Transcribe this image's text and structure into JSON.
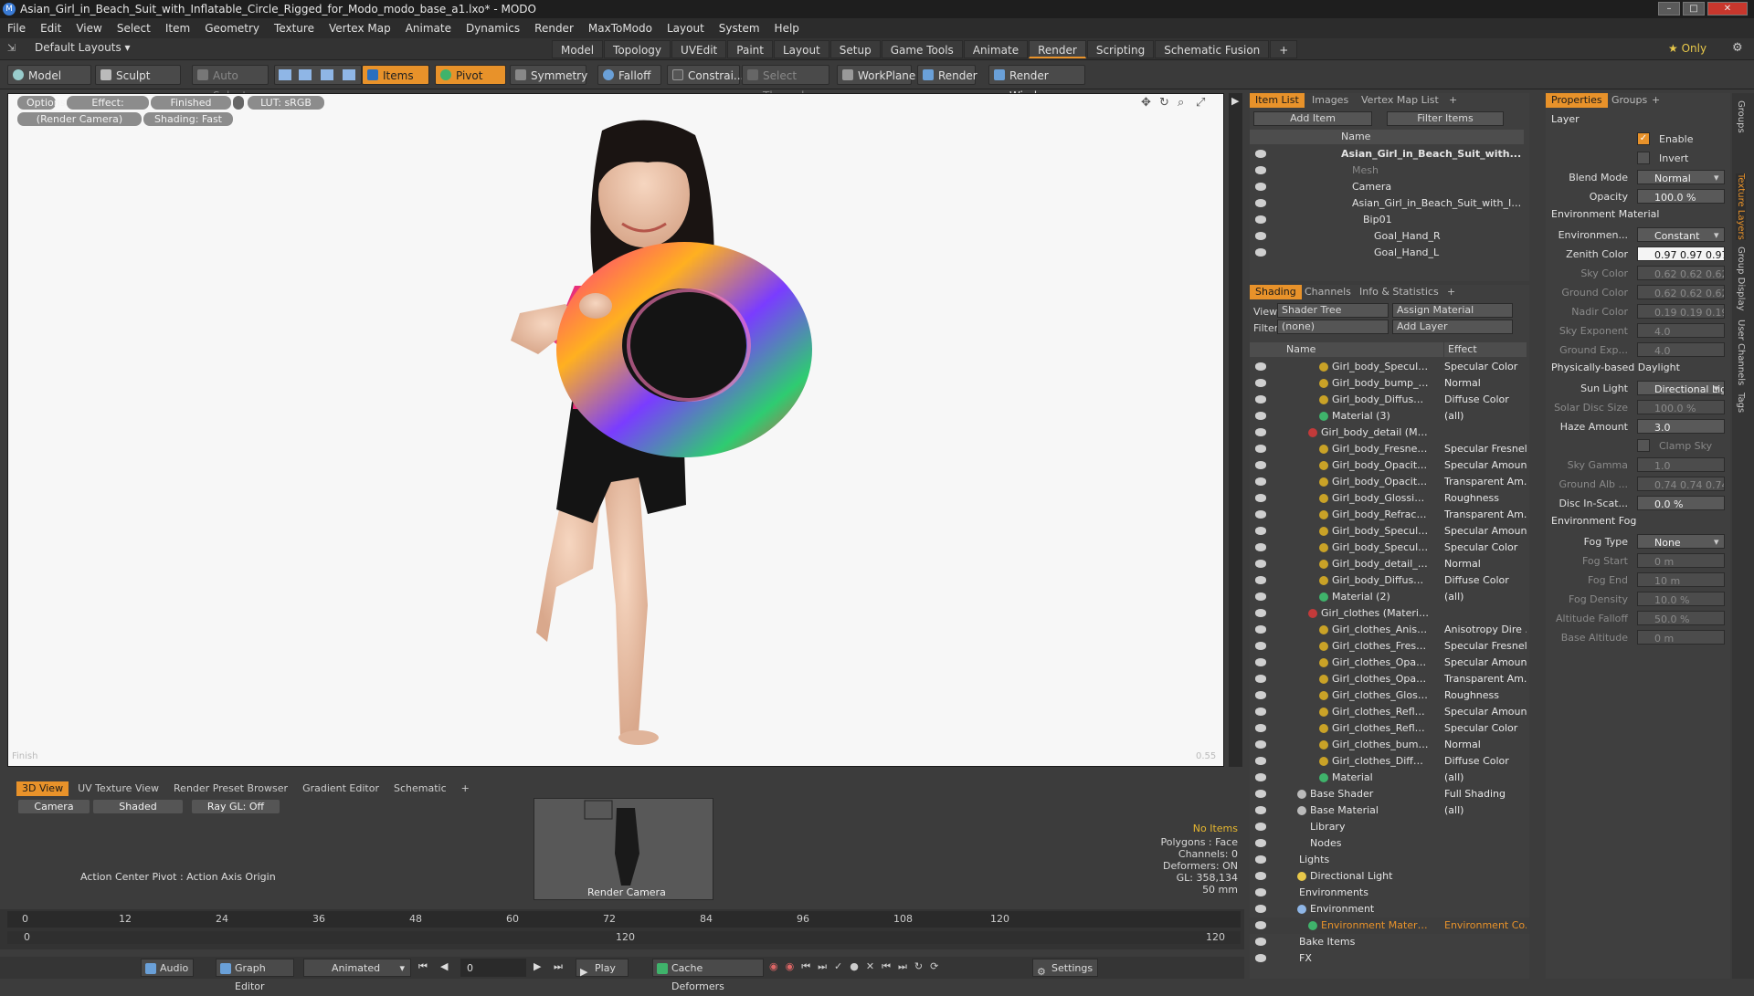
{
  "window": {
    "title": "Asian_Girl_in_Beach_Suit_with_Inflatable_Circle_Rigged_for_Modo_modo_base_a1.lxo* - MODO"
  },
  "menu": [
    "File",
    "Edit",
    "View",
    "Select",
    "Item",
    "Geometry",
    "Texture",
    "Vertex Map",
    "Animate",
    "Dynamics",
    "Render",
    "MaxToModo",
    "Layout",
    "System",
    "Help"
  ],
  "layout": {
    "dropdown": "Default Layouts ▾",
    "tabs": [
      "Model",
      "Topology",
      "UVEdit",
      "Paint",
      "Layout",
      "Setup",
      "Game Tools",
      "Animate",
      "Render",
      "Scripting",
      "Schematic Fusion",
      "+"
    ],
    "active": "Render",
    "only": "★ Only"
  },
  "toolbar": {
    "model": "Model",
    "sculpt": "Sculpt",
    "auto_select": "Auto Select",
    "items": "Items",
    "pivot": "Pivot",
    "symmetry": "Symmetry",
    "falloff": "Falloff",
    "constraints": "Constrai...",
    "select_through": "Select Through",
    "workplane": "WorkPlane",
    "render": "Render",
    "render_window": "Render Window"
  },
  "viewport": {
    "options": "Options",
    "effect": "Effect: (Shadi...",
    "finished": "Finished",
    "lut": "LUT: sRGB",
    "camera": "(Render Camera)",
    "shading": "Shading: Fast",
    "corner_left": "Finish",
    "corner_right": "0.55"
  },
  "bottom": {
    "tabs": [
      "3D View",
      "UV Texture View",
      "Render Preset Browser",
      "Gradient Editor",
      "Schematic",
      "+"
    ],
    "camera": "Camera",
    "shaded": "Shaded",
    "raygl": "Ray GL: Off",
    "action": "Action Center Pivot : Action Axis Origin",
    "render_camera": "Render Camera",
    "info": [
      "No Items",
      "Polygons : Face",
      "Channels: 0",
      "Deformers: ON",
      "GL: 358,134",
      "50 mm"
    ]
  },
  "timeline": {
    "ticks": [
      "0",
      "12",
      "24",
      "36",
      "48",
      "60",
      "72",
      "84",
      "96",
      "108",
      "120"
    ],
    "sub": [
      "0",
      "120",
      "120"
    ]
  },
  "playbar": {
    "audio": "Audio",
    "graph": "Graph Editor",
    "animated": "Animated",
    "frame": "0",
    "play": "Play",
    "cache": "Cache Deformers",
    "settings": "Settings"
  },
  "itemlist": {
    "tabs": [
      "Item List",
      "Images",
      "Vertex Map List",
      "+"
    ],
    "add_item": "Add Item",
    "filter": "Filter Items",
    "col": "Name",
    "rows": [
      {
        "t": "Asian_Girl_in_Beach_Suit_with...",
        "d": 0,
        "b": true
      },
      {
        "t": "Mesh",
        "d": 1,
        "dim": true
      },
      {
        "t": "Camera",
        "d": 1
      },
      {
        "t": "Asian_Girl_in_Beach_Suit_with_In...",
        "d": 1
      },
      {
        "t": "Bip01",
        "d": 2
      },
      {
        "t": "Goal_Hand_R",
        "d": 3
      },
      {
        "t": "Goal_Hand_L",
        "d": 3
      }
    ]
  },
  "shading": {
    "tabs": [
      "Shading",
      "Channels",
      "Info & Statistics",
      "+"
    ],
    "view_label": "View",
    "view": "Shader Tree",
    "assign": "Assign Material",
    "filter_label": "Filter",
    "filter": "(none)",
    "add_layer": "Add Layer",
    "col_name": "Name",
    "col_effect": "Effect",
    "rows": [
      {
        "n": "Girl_body_Specular...",
        "e": "Specular Color",
        "d": 3,
        "c": "#c9a227"
      },
      {
        "n": "Girl_body_bump_b ...",
        "e": "Normal",
        "d": 3,
        "c": "#c9a227"
      },
      {
        "n": "Girl_body_Diffuse (...",
        "e": "Diffuse Color",
        "d": 3,
        "c": "#c9a227"
      },
      {
        "n": "Material (3)",
        "e": "(all)",
        "d": 3,
        "c": "#3fb36b"
      },
      {
        "n": "Girl_body_detail (Mat...",
        "e": "",
        "d": 2,
        "c": "#c23a3a"
      },
      {
        "n": "Girl_body_Fresnel ...",
        "e": "Specular Fresnel",
        "d": 3,
        "c": "#c9a227"
      },
      {
        "n": "Girl_body_Opacity ...",
        "e": "Specular Amount",
        "d": 3,
        "c": "#c9a227"
      },
      {
        "n": "Girl_body_Opacity ...",
        "e": "Transparent Am...",
        "d": 3,
        "c": "#c9a227"
      },
      {
        "n": "Girl_body_Glossine ...",
        "e": "Roughness",
        "d": 3,
        "c": "#c9a227"
      },
      {
        "n": "Girl_body_Refracti ...",
        "e": "Transparent Am...",
        "d": 3,
        "c": "#c9a227"
      },
      {
        "n": "Girl_body_Specular...",
        "e": "Specular Amount",
        "d": 3,
        "c": "#c9a227"
      },
      {
        "n": "Girl_body_Specular...",
        "e": "Specular Color",
        "d": 3,
        "c": "#c9a227"
      },
      {
        "n": "Girl_body_detail_b ...",
        "e": "Normal",
        "d": 3,
        "c": "#c9a227"
      },
      {
        "n": "Girl_body_Diffuse (...",
        "e": "Diffuse Color",
        "d": 3,
        "c": "#c9a227"
      },
      {
        "n": "Material (2)",
        "e": "(all)",
        "d": 3,
        "c": "#3fb36b"
      },
      {
        "n": "Girl_clothes (Material)",
        "e": "",
        "d": 2,
        "c": "#c23a3a"
      },
      {
        "n": "Girl_clothes_Anisot ...",
        "e": "Anisotropy Dire ...",
        "d": 3,
        "c": "#c9a227"
      },
      {
        "n": "Girl_clothes_Fresn ...",
        "e": "Specular Fresnel",
        "d": 3,
        "c": "#c9a227"
      },
      {
        "n": "Girl_clothes_Opacit...",
        "e": "Specular Amount",
        "d": 3,
        "c": "#c9a227"
      },
      {
        "n": "Girl_clothes_Opacit...",
        "e": "Transparent Am...",
        "d": 3,
        "c": "#c9a227"
      },
      {
        "n": "Girl_clothes_Glossi ...",
        "e": "Roughness",
        "d": 3,
        "c": "#c9a227"
      },
      {
        "n": "Girl_clothes_Reflec ...",
        "e": "Specular Amount",
        "d": 3,
        "c": "#c9a227"
      },
      {
        "n": "Girl_clothes_Reflec ...",
        "e": "Specular Color",
        "d": 3,
        "c": "#c9a227"
      },
      {
        "n": "Girl_clothes_bump_...",
        "e": "Normal",
        "d": 3,
        "c": "#c9a227"
      },
      {
        "n": "Girl_clothes_Diffus ...",
        "e": "Diffuse Color",
        "d": 3,
        "c": "#c9a227"
      },
      {
        "n": "Material",
        "e": "(all)",
        "d": 3,
        "c": "#3fb36b"
      },
      {
        "n": "Base Shader",
        "e": "Full Shading",
        "d": 1,
        "c": "#bbbbbb"
      },
      {
        "n": "Base Material",
        "e": "(all)",
        "d": 1,
        "c": "#bbbbbb"
      },
      {
        "n": "Library",
        "e": "",
        "d": 1,
        "c": ""
      },
      {
        "n": "Nodes",
        "e": "",
        "d": 1,
        "c": ""
      },
      {
        "n": "Lights",
        "e": "",
        "d": 0,
        "c": ""
      },
      {
        "n": "Directional Light",
        "e": "",
        "d": 1,
        "c": "#e8c84a"
      },
      {
        "n": "Environments",
        "e": "",
        "d": 0,
        "c": ""
      },
      {
        "n": "Environment",
        "e": "",
        "d": 1,
        "c": "#8fb6e6"
      },
      {
        "n": "Environment Material",
        "e": "Environment Co...",
        "d": 2,
        "c": "#3fb36b",
        "sel": true
      },
      {
        "n": "Bake Items",
        "e": "",
        "d": 0,
        "c": ""
      },
      {
        "n": "FX",
        "e": "",
        "d": 0,
        "c": ""
      }
    ]
  },
  "props": {
    "tabs": [
      "Properties",
      "Groups",
      "+"
    ],
    "layer": "Layer",
    "rows": [
      {
        "l": "",
        "v": "Enable",
        "k": "check"
      },
      {
        "l": "",
        "v": "Invert",
        "k": "check2"
      },
      {
        "l": "Blend Mode",
        "v": "Normal",
        "k": "drop"
      },
      {
        "l": "Opacity",
        "v": "100.0 %",
        "k": "num"
      },
      {
        "s": "Environment Material"
      },
      {
        "l": "Environmen...",
        "v": "Constant",
        "k": "drop"
      },
      {
        "l": "Zenith Color",
        "v": "0.97 0.97 0.97",
        "k": "white"
      },
      {
        "l": "Sky Color",
        "v": "0.62 0.62 0.62",
        "k": "dim"
      },
      {
        "l": "Ground Color",
        "v": "0.62 0.62 0.62",
        "k": "dim"
      },
      {
        "l": "Nadir Color",
        "v": "0.19 0.19 0.19",
        "k": "dim"
      },
      {
        "l": "Sky Exponent",
        "v": "4.0",
        "k": "dim"
      },
      {
        "l": "Ground Exp...",
        "v": "4.0",
        "k": "dim"
      },
      {
        "s": "Physically-based Daylight"
      },
      {
        "l": "Sun Light",
        "v": "Directional Light",
        "k": "drop"
      },
      {
        "l": "Solar Disc Size",
        "v": "100.0 %",
        "k": "dim"
      },
      {
        "l": "Haze Amount",
        "v": "3.0",
        "k": "num"
      },
      {
        "l": "",
        "v": "Clamp Sky Brig...",
        "k": "dimcheck"
      },
      {
        "l": "Sky Gamma",
        "v": "1.0",
        "k": "dim"
      },
      {
        "l": "Ground Alb ...",
        "v": "0.74 0.74 0.74",
        "k": "dim"
      },
      {
        "l": "Disc In-Scat...",
        "v": "0.0 %",
        "k": "num"
      },
      {
        "s": "Environment Fog"
      },
      {
        "l": "Fog Type",
        "v": "None",
        "k": "drop"
      },
      {
        "l": "Fog Start",
        "v": "0 m",
        "k": "dim"
      },
      {
        "l": "Fog End",
        "v": "10 m",
        "k": "dim"
      },
      {
        "l": "Fog Density",
        "v": "10.0 %",
        "k": "dim"
      },
      {
        "l": "Altitude Falloff",
        "v": "50.0 %",
        "k": "dim"
      },
      {
        "l": "Base Altitude",
        "v": "0 m",
        "k": "dim"
      }
    ]
  },
  "side_tabs": [
    "Groups",
    "Texture Layers",
    "Group Display",
    "User Channels",
    "Tags"
  ]
}
